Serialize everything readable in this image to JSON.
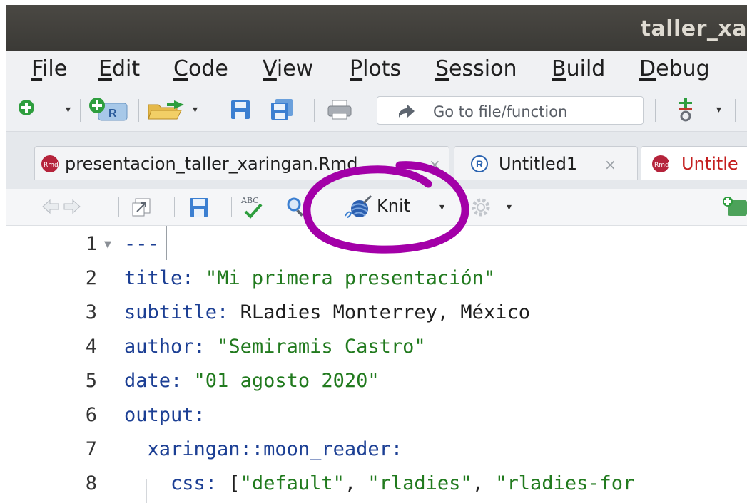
{
  "window": {
    "title": "taller_xa"
  },
  "menu": {
    "items": [
      {
        "mn": "F",
        "rest": "ile"
      },
      {
        "mn": "E",
        "rest": "dit"
      },
      {
        "mn": "C",
        "rest": "ode"
      },
      {
        "mn": "V",
        "rest": "iew"
      },
      {
        "mn": "P",
        "rest": "lots"
      },
      {
        "mn": "S",
        "rest": "ession"
      },
      {
        "mn": "B",
        "rest": "uild"
      },
      {
        "mn": "D",
        "rest": "ebug"
      }
    ]
  },
  "toolbar": {
    "goto_placeholder": "Go to file/function",
    "icons": [
      "new-file-icon",
      "new-project-icon",
      "open-folder-icon",
      "save-icon",
      "save-all-icon",
      "print-icon",
      "git-icon"
    ]
  },
  "tabs": [
    {
      "label": "presentacion_taller_xaringan.Rmd",
      "close": "×",
      "icon": "rmd-icon"
    },
    {
      "label": "Untitled1",
      "close": "×",
      "icon": "r-script-icon"
    },
    {
      "label": "Untitle",
      "icon": "rmd-icon",
      "active": true
    }
  ],
  "editor_toolbar": {
    "knit_label": "Knit",
    "icons": [
      "back-arrow-icon",
      "forward-arrow-icon",
      "show-in-window-icon",
      "save-icon",
      "spellcheck-icon",
      "search-icon",
      "knit-icon",
      "gear-icon",
      "insert-chunk-icon"
    ],
    "spellcheck_label": "ABC"
  },
  "editor": {
    "lines": [
      {
        "n": "1",
        "fold": true,
        "parts": [
          {
            "t": "---",
            "c": "k"
          }
        ]
      },
      {
        "n": "2",
        "parts": [
          {
            "t": "title:",
            "c": "k"
          },
          {
            "t": " ",
            "c": "p"
          },
          {
            "t": "\"Mi primera presentación\"",
            "c": "s"
          }
        ]
      },
      {
        "n": "3",
        "parts": [
          {
            "t": "subtitle:",
            "c": "k"
          },
          {
            "t": " RLadies Monterrey, México",
            "c": "p"
          }
        ]
      },
      {
        "n": "4",
        "parts": [
          {
            "t": "author:",
            "c": "k"
          },
          {
            "t": " ",
            "c": "p"
          },
          {
            "t": "\"Semiramis Castro\"",
            "c": "s"
          }
        ]
      },
      {
        "n": "5",
        "parts": [
          {
            "t": "date:",
            "c": "k"
          },
          {
            "t": " ",
            "c": "p"
          },
          {
            "t": "\"01 agosto 2020\"",
            "c": "s"
          }
        ]
      },
      {
        "n": "6",
        "parts": [
          {
            "t": "output:",
            "c": "k"
          }
        ]
      },
      {
        "n": "7",
        "parts": [
          {
            "t": "  xaringan::moon_reader:",
            "c": "k"
          }
        ]
      },
      {
        "n": "8",
        "parts": [
          {
            "t": "    css:",
            "c": "k"
          },
          {
            "t": " [",
            "c": "p"
          },
          {
            "t": "\"default\"",
            "c": "s"
          },
          {
            "t": ", ",
            "c": "p"
          },
          {
            "t": "\"rladies\"",
            "c": "s"
          },
          {
            "t": ", ",
            "c": "p"
          },
          {
            "t": "\"rladies-for",
            "c": "s"
          }
        ]
      }
    ]
  },
  "colors": {
    "annotation": "#a300a8",
    "keyword": "#1c3f94",
    "string": "#217a1e",
    "active_tab_text": "#c41e1e"
  }
}
